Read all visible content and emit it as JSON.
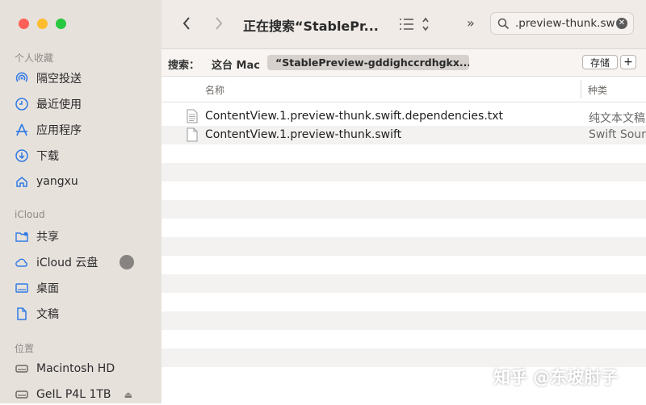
{
  "window": {
    "title": "正在搜索“StablePr..."
  },
  "sidebar": {
    "sections": [
      {
        "heading": "个人收藏",
        "items": [
          {
            "label": "隔空投送",
            "icon": "airdrop-icon"
          },
          {
            "label": "最近使用",
            "icon": "clock-icon"
          },
          {
            "label": "应用程序",
            "icon": "applications-icon"
          },
          {
            "label": "下载",
            "icon": "download-icon"
          },
          {
            "label": "yangxu",
            "icon": "home-icon"
          }
        ]
      },
      {
        "heading": "iCloud",
        "items": [
          {
            "label": "共享",
            "icon": "shared-folder-icon"
          },
          {
            "label": "iCloud 云盘",
            "icon": "cloud-icon"
          },
          {
            "label": "桌面",
            "icon": "desktop-icon"
          },
          {
            "label": "文稿",
            "icon": "document-icon"
          }
        ]
      },
      {
        "heading": "位置",
        "items": [
          {
            "label": "Macintosh HD",
            "icon": "disk-icon"
          },
          {
            "label": "GeIL P4L 1TB",
            "icon": "disk-icon"
          }
        ]
      }
    ],
    "eject_glyph": "⏏"
  },
  "toolbar": {
    "more_label": "»"
  },
  "search": {
    "value": ".preview-thunk.swift",
    "clear_glyph": "✕"
  },
  "scope": {
    "label": "搜索：",
    "this_mac": "这台 Mac",
    "selected": "“StablePreview-gddighccrdhgkx...",
    "save_label": "存储",
    "add_label": "+"
  },
  "columns": {
    "name": "名称",
    "kind": "种类"
  },
  "files": [
    {
      "name": "ContentView.1.preview-thunk.swift.dependencies.txt",
      "kind": "纯文本文稿"
    },
    {
      "name": "ContentView.1.preview-thunk.swift",
      "kind": "Swift Source"
    }
  ],
  "watermark": "知乎 @东坡肘子",
  "colors": {
    "sidebar_bg": "#e7e1dc",
    "titlebar_bg": "#f0ebe7",
    "close": "#fe5f57",
    "minimize": "#febc2e",
    "zoom": "#28c840",
    "accent": "#2f7ae5"
  }
}
